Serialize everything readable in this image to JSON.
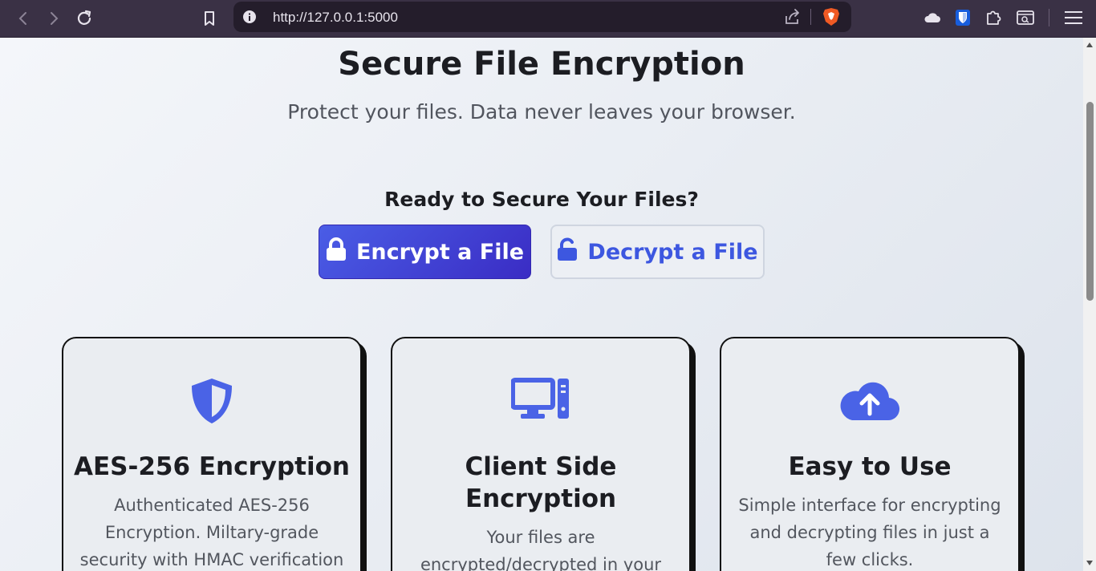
{
  "browser": {
    "url": "http://127.0.0.1:5000"
  },
  "page": {
    "title": "Secure File Encryption",
    "subtitle": "Protect your files. Data never leaves your browser.",
    "ready_heading": "Ready to Secure Your Files?",
    "encrypt_button": "Encrypt a File",
    "decrypt_button": "Decrypt a File"
  },
  "features": [
    {
      "icon": "shield-icon",
      "title": "AES-256 Encryption",
      "description": "Authenticated AES-256 Encryption. Miltary-grade security with HMAC verification"
    },
    {
      "icon": "desktop-icon",
      "title": "Client Side Encryption",
      "description": "Your files are encrypted/decrypted in your"
    },
    {
      "icon": "cloud-upload-icon",
      "title": "Easy to Use",
      "description": "Simple interface for encrypting and decrypting files in just a few clicks."
    }
  ],
  "colors": {
    "accent": "#3d57e0",
    "chrome": "#3a3145"
  }
}
